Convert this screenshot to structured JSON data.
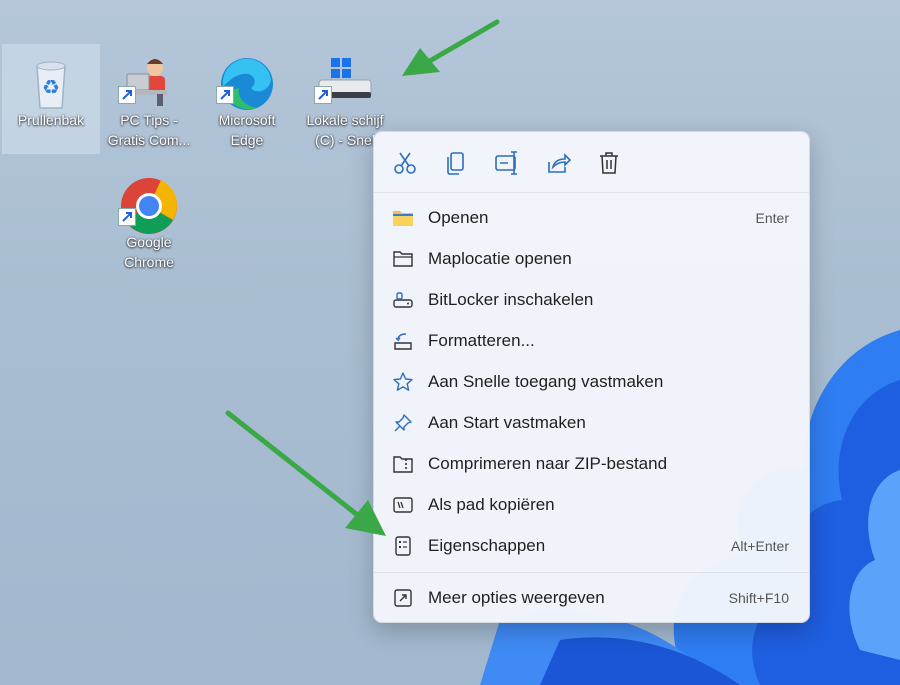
{
  "desktop": {
    "icons": [
      {
        "label": "Prullenbak",
        "name": "recycle-bin-icon"
      },
      {
        "label": "PC Tips -\nGratis Com...",
        "name": "pc-tips-icon"
      },
      {
        "label": "Microsoft\nEdge",
        "name": "edge-icon"
      },
      {
        "label": "Lokale schijf\n(C) - Snel",
        "name": "drive-icon"
      },
      {
        "label": "Google\nChrome",
        "name": "chrome-icon"
      }
    ]
  },
  "context_menu": {
    "toolbar": [
      "cut-icon",
      "copy-icon",
      "rename-icon",
      "share-icon",
      "delete-icon"
    ],
    "items": [
      {
        "label": "Openen",
        "shortcut": "Enter",
        "icon": "folder-icon"
      },
      {
        "label": "Maplocatie openen",
        "shortcut": "",
        "icon": "folder-outline-icon"
      },
      {
        "label": "BitLocker inschakelen",
        "shortcut": "",
        "icon": "bitlocker-key-icon"
      },
      {
        "label": "Formatteren...",
        "shortcut": "",
        "icon": "format-icon"
      },
      {
        "label": "Aan Snelle toegang vastmaken",
        "shortcut": "",
        "icon": "star-icon"
      },
      {
        "label": "Aan Start vastmaken",
        "shortcut": "",
        "icon": "pin-icon"
      },
      {
        "label": "Comprimeren naar ZIP-bestand",
        "shortcut": "",
        "icon": "zip-icon"
      },
      {
        "label": "Als pad kopiëren",
        "shortcut": "",
        "icon": "copy-path-icon"
      },
      {
        "label": "Eigenschappen",
        "shortcut": "Alt+Enter",
        "icon": "properties-icon"
      },
      {
        "label": "Meer opties weergeven",
        "shortcut": "Shift+F10",
        "icon": "more-options-icon"
      }
    ]
  },
  "colors": {
    "accent": "#2d6dbd",
    "arrow": "#3aa846"
  }
}
